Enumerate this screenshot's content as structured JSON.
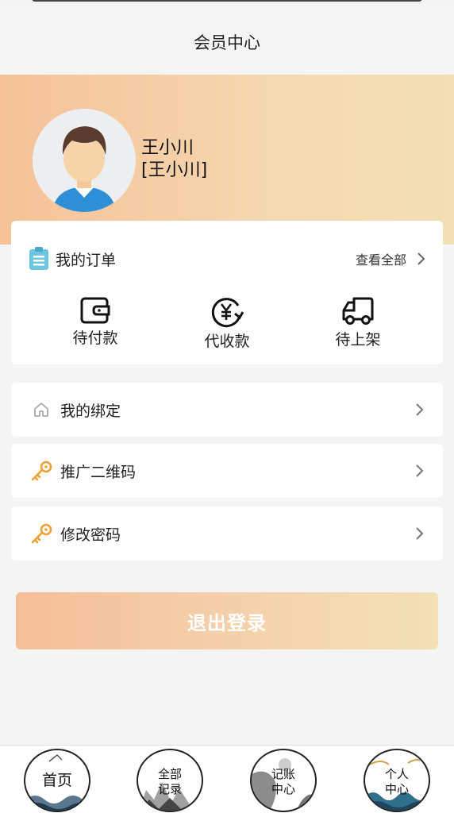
{
  "header": {
    "title": "会员中心"
  },
  "profile": {
    "name": "王小川",
    "alias": "[王小川]"
  },
  "orders": {
    "title": "我的订单",
    "view_all": "查看全部",
    "items": [
      {
        "label": "待付款",
        "icon": "wallet-icon"
      },
      {
        "label": "代收款",
        "icon": "yen-refresh-icon"
      },
      {
        "label": "待上架",
        "icon": "truck-icon"
      }
    ]
  },
  "menu": [
    {
      "label": "我的绑定",
      "icon": "home-icon"
    },
    {
      "label": "推广二维码",
      "icon": "key-icon"
    },
    {
      "label": "修改密码",
      "icon": "key-icon"
    }
  ],
  "logout": {
    "label": "退出登录"
  },
  "tabbar": [
    {
      "label": "首页"
    },
    {
      "label_line1": "全部",
      "label_line2": "记录"
    },
    {
      "label_line1": "记账",
      "label_line2": "中心"
    },
    {
      "label_line1": "个人",
      "label_line2": "中心"
    }
  ],
  "colors": {
    "banner_start": "#f6c197",
    "banner_end": "#f3dfb4",
    "key_icon": "#f0a030",
    "doc_icon": "#6cc6e0"
  }
}
